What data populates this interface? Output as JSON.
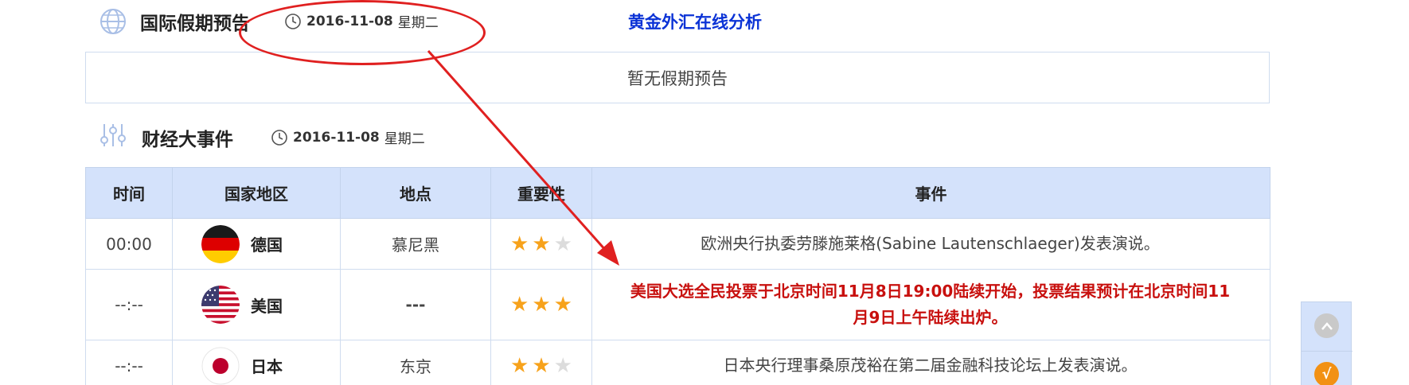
{
  "holidays": {
    "title": "国际假期预告",
    "date": "2016-11-08",
    "weekday": "星期二",
    "link_label": "黄金外汇在线分析",
    "empty_text": "暂无假期预告"
  },
  "events": {
    "title": "财经大事件",
    "date": "2016-11-08",
    "weekday": "星期二",
    "columns": [
      "时间",
      "国家地区",
      "地点",
      "重要性",
      "事件"
    ],
    "rows": [
      {
        "time": "00:00",
        "country": "德国",
        "flag": "germany-flag-icon",
        "place": "慕尼黑",
        "importance": 2,
        "text": "欧洲央行执委劳滕施莱格(Sabine Lautenschlaeger)发表演说。",
        "highlight": false
      },
      {
        "time": "--:--",
        "country": "美国",
        "flag": "usa-flag-icon",
        "place": "---",
        "importance": 3,
        "text": "美国大选全民投票于北京时间11月8日19:00陆续开始，投票结果预计在北京时间11月9日上午陆续出炉。",
        "highlight": true
      },
      {
        "time": "--:--",
        "country": "日本",
        "flag": "japan-flag-icon",
        "place": "东京",
        "importance": 2,
        "text": "日本央行理事桑原茂裕在第二届金融科技论坛上发表演说。",
        "highlight": false
      }
    ]
  },
  "side_tools": {
    "up_icon": "back-to-top-icon",
    "check_icon": "checkmark-icon",
    "check_glyph": "√"
  },
  "colors": {
    "link": "#0b33d6",
    "header_bg": "#d4e2fb",
    "highlight_text": "#c8100e",
    "star_on": "#f7a21b",
    "star_off": "#dcdcdc",
    "annotation": "#e02020"
  }
}
